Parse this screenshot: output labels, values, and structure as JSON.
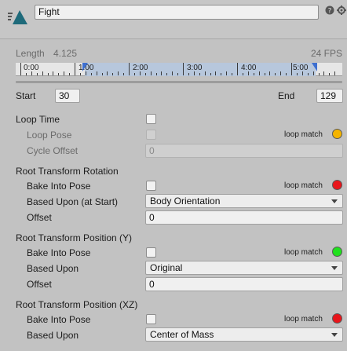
{
  "header": {
    "clip_name": "Fight",
    "icons": [
      "animation-clip-icon",
      "help-icon",
      "settings-icon"
    ]
  },
  "info": {
    "length_label": "Length",
    "length_value": "4.125",
    "fps": "24 FPS"
  },
  "timeline": {
    "labels": [
      "0:00",
      "1:00",
      "2:00",
      "3:00",
      "4:00",
      "5:00"
    ]
  },
  "range": {
    "start_label": "Start",
    "start_value": "30",
    "end_label": "End",
    "end_value": "129"
  },
  "loop": {
    "loop_time_label": "Loop Time",
    "loop_pose_label": "Loop Pose",
    "cycle_offset_label": "Cycle Offset",
    "cycle_offset_value": "0",
    "loop_match_label": "loop match",
    "loop_match_color": "#f4b400"
  },
  "rotation": {
    "section_label": "Root Transform Rotation",
    "bake_label": "Bake Into Pose",
    "loop_match_label": "loop match",
    "loop_match_color": "#e8151b",
    "based_upon_label": "Based Upon (at Start)",
    "based_upon_value": "Body Orientation",
    "offset_label": "Offset",
    "offset_value": "0"
  },
  "position_y": {
    "section_label": "Root Transform Position (Y)",
    "bake_label": "Bake Into Pose",
    "loop_match_label": "loop match",
    "loop_match_color": "#20e11d",
    "based_upon_label": "Based Upon",
    "based_upon_value": "Original",
    "offset_label": "Offset",
    "offset_value": "0"
  },
  "position_xz": {
    "section_label": "Root Transform Position (XZ)",
    "bake_label": "Bake Into Pose",
    "loop_match_label": "loop match",
    "loop_match_color": "#e8151b",
    "based_upon_label": "Based Upon",
    "based_upon_value": "Center of Mass"
  }
}
